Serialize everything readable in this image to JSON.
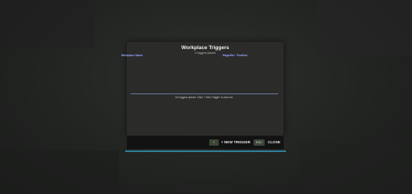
{
  "dialog": {
    "title": "Workplace Triggers",
    "subtitle": "0 triggers placed",
    "columns": {
      "name": "Workplace Name",
      "magnifier": "Magnifier · Position"
    },
    "empty_message": "No triggers placed. Click '+ New Trigger' to add one."
  },
  "footer": {
    "new_trigger_key": "F",
    "new_trigger_label": "+ NEW TRIGGER",
    "close_key": "ESC",
    "close_label": "CLOSE"
  },
  "colors": {
    "accent": "#2f7f9a",
    "header_text": "#9aa6ff",
    "panel_bg": "#2b2b2a"
  }
}
